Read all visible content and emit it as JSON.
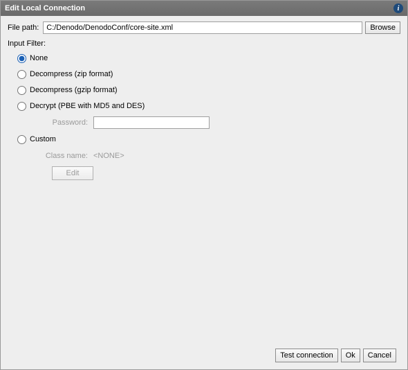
{
  "title": "Edit Local Connection",
  "file": {
    "label": "File path:",
    "value": "C:/Denodo/DenodoConf/core-site.xml",
    "browse": "Browse"
  },
  "filter": {
    "label": "Input Filter:",
    "options": {
      "none": "None",
      "zip": "Decompress (zip format)",
      "gzip": "Decompress (gzip format)",
      "decrypt": "Decrypt (PBE with MD5 and DES)",
      "custom": "Custom"
    },
    "selected": "none",
    "password_label": "Password:",
    "password_value": "",
    "classname_label": "Class name:",
    "classname_value": "<NONE>",
    "edit": "Edit"
  },
  "footer": {
    "test": "Test connection",
    "ok": "Ok",
    "cancel": "Cancel"
  }
}
